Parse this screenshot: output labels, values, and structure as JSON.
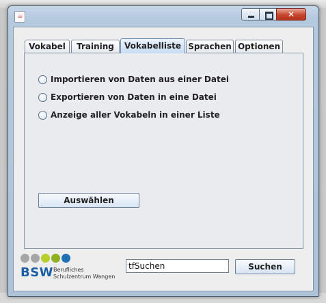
{
  "window": {
    "controls": {
      "minimize": "minimize",
      "maximize": "maximize",
      "close": "close"
    }
  },
  "tabs": [
    {
      "label": "Vokabel",
      "active": false
    },
    {
      "label": "Training",
      "active": false
    },
    {
      "label": "Vokabelliste",
      "active": true
    },
    {
      "label": "Sprachen",
      "active": false
    },
    {
      "label": "Optionen",
      "active": false
    }
  ],
  "options": [
    {
      "label": "Importieren von Daten aus einer Datei",
      "selected": false
    },
    {
      "label": "Exportieren von Daten in eine Datei",
      "selected": false
    },
    {
      "label": "Anzeige aller Vokabeln in einer Liste",
      "selected": false
    }
  ],
  "select_button": "Auswählen",
  "search": {
    "value": "tfSuchen",
    "button": "Suchen"
  },
  "logo": {
    "text": "BSW",
    "line1": "Berufliches",
    "line2": "Schulzentrum Wangen",
    "dot_colors": [
      "#a6a6a6",
      "#a6a6a6",
      "#b7cf2a",
      "#8fb022",
      "#1f6fb5"
    ]
  }
}
